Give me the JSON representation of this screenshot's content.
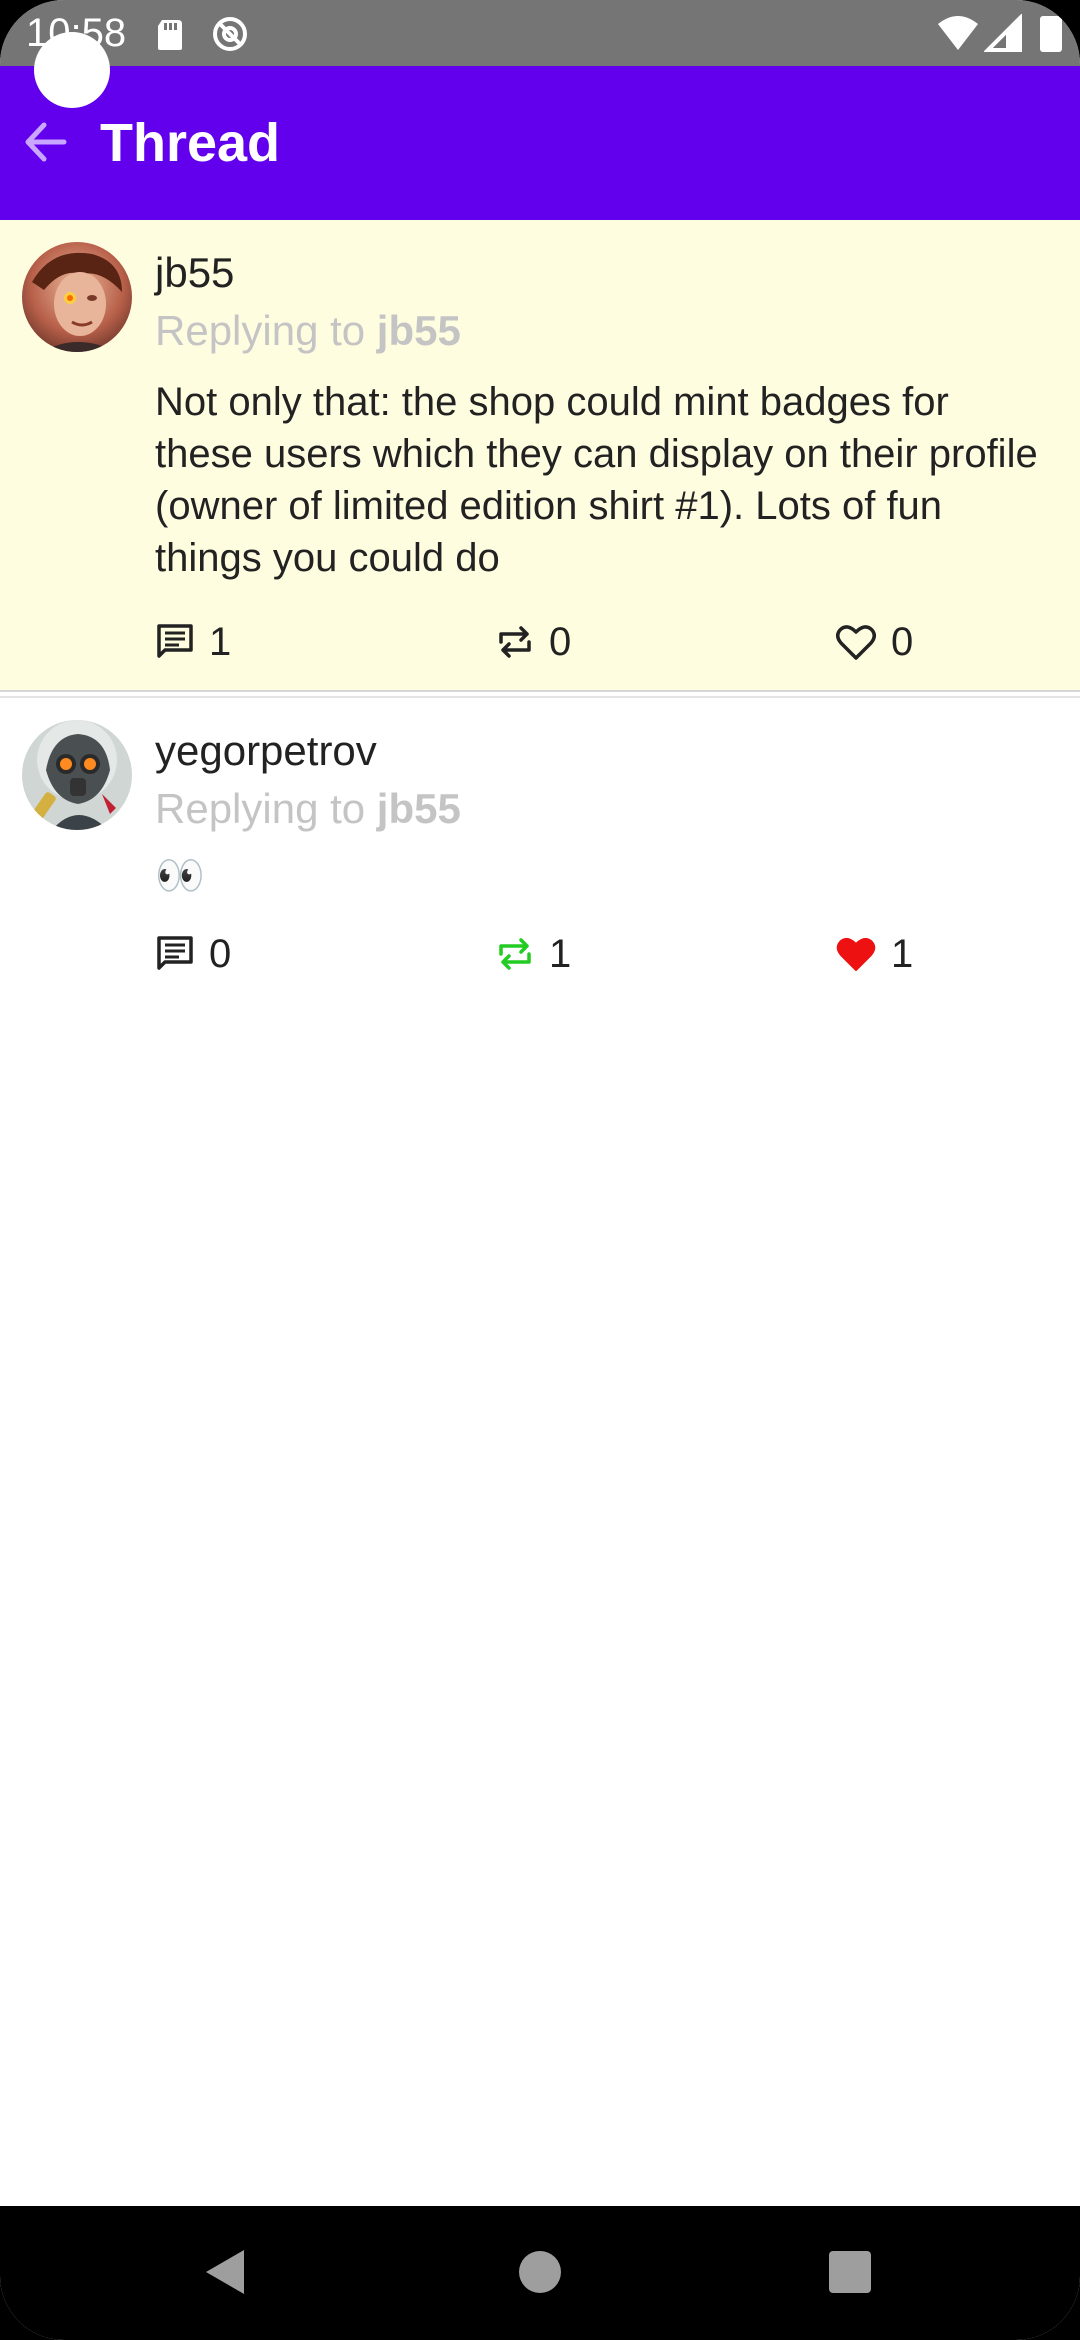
{
  "status_bar": {
    "time": "10:58",
    "icons": [
      "sd-card-icon",
      "at-sign-icon",
      "wifi-icon",
      "signal-icon",
      "battery-icon"
    ]
  },
  "app_bar": {
    "title": "Thread",
    "back_icon": "arrow-left-icon",
    "background": "#6200ee"
  },
  "posts": [
    {
      "username": "jb55",
      "reply_prefix": "Replying to ",
      "reply_to": "jb55",
      "text": "Not only that: the shop could mint badges for these users which they can display on their profile (owner of limited edition shirt #1). Lots of fun things you could do",
      "replies": "1",
      "reposts": "0",
      "likes": "0",
      "reposted": false,
      "liked": false,
      "background": "#fffde0"
    },
    {
      "username": "yegorpetrov",
      "reply_prefix": "Replying to ",
      "reply_to": "jb55",
      "text": "👀",
      "replies": "0",
      "reposts": "1",
      "likes": "1",
      "reposted": true,
      "liked": true,
      "background": "#ffffff"
    }
  ],
  "colors": {
    "reposted": "#22cc22",
    "liked": "#ee1111",
    "muted_text": "#c4c4c4"
  },
  "nav_bar": {
    "items": [
      "back-triangle-icon",
      "home-circle-icon",
      "recents-square-icon"
    ]
  }
}
